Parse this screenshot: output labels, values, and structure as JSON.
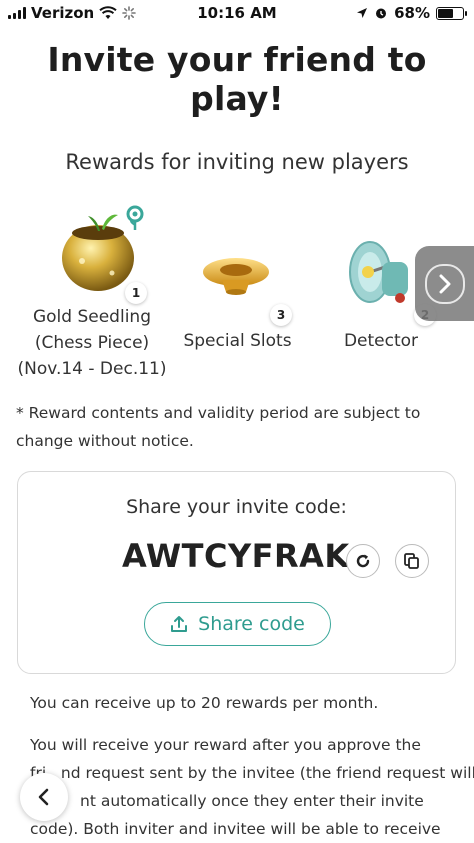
{
  "status_bar": {
    "carrier": "Verizon",
    "time": "10:16 AM",
    "battery": "68%",
    "battery_level": 0.68,
    "icons": [
      "signal-icon",
      "wifi-icon",
      "loading-icon",
      "location-icon",
      "alarm-icon",
      "battery-icon"
    ]
  },
  "page": {
    "title": "Invite your friend to play!",
    "rewards_title": "Rewards for inviting new players"
  },
  "rewards": [
    {
      "name_line1": "Gold Seedling",
      "name_line2": "(Chess Piece)",
      "name_line3": "(Nov.14 - Dec.11)",
      "count": "1",
      "image": "gold-seedling-pot"
    },
    {
      "name_line1": "Special Slots",
      "count": "3",
      "image": "special-slots-dish"
    },
    {
      "name_line1": "Detector",
      "count": "2",
      "image": "detector-device"
    }
  ],
  "disclaimer": "* Reward contents and validity period are subject to change without notice.",
  "invite": {
    "label": "Share your invite code:",
    "code": "AWTCYFRAK",
    "share_label": "Share code"
  },
  "info": {
    "line1": "You can receive up to 20 rewards per month.",
    "para2_line1": "You will receive your reward after you approve the",
    "para2_line2": "fri   nd request sent by the invitee (the friend request will",
    "para2_line3": "nt automatically once they enter their invite",
    "para2_line4": "code). Both inviter and invitee will be able to receive"
  },
  "colors": {
    "accent": "#2f9c8f",
    "text": "#333333",
    "border": "#d9d9d9"
  }
}
